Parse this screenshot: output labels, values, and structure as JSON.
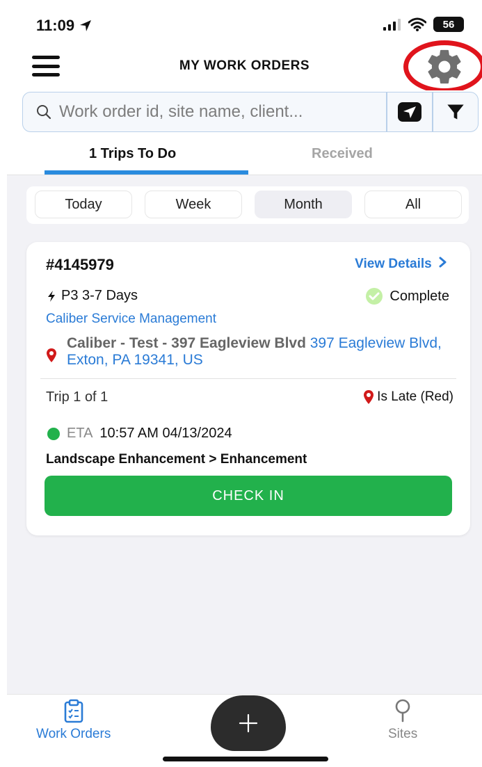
{
  "status_bar": {
    "time": "11:09",
    "battery": "56"
  },
  "header": {
    "title": "MY WORK ORDERS"
  },
  "search": {
    "placeholder": "Work order id, site name, client..."
  },
  "tabs": {
    "todo": "1 Trips To Do",
    "received": "Received"
  },
  "segments": [
    {
      "label": "Today"
    },
    {
      "label": "Week"
    },
    {
      "label": "Month",
      "selected": true
    },
    {
      "label": "All"
    }
  ],
  "card": {
    "id": "#4145979",
    "view_details": "View Details",
    "priority": "P3 3-7 Days",
    "status": "Complete",
    "client": "Caliber Service Management",
    "site_name": "Caliber - Test - 397 Eagleview Blvd",
    "site_address": "397 Eagleview Blvd, Exton, PA 19341, US",
    "trip": "Trip 1 of 1",
    "late": "Is Late (Red)",
    "eta_label": "ETA",
    "eta_value": "10:57 AM 04/13/2024",
    "service": "Landscape Enhancement > Enhancement",
    "checkin": "CHECK IN"
  },
  "tabbar": {
    "work_orders": "Work Orders",
    "sites": "Sites"
  },
  "colors": {
    "accent": "#2a7bd6",
    "success": "#22b14c",
    "highlight": "#e0141c"
  }
}
